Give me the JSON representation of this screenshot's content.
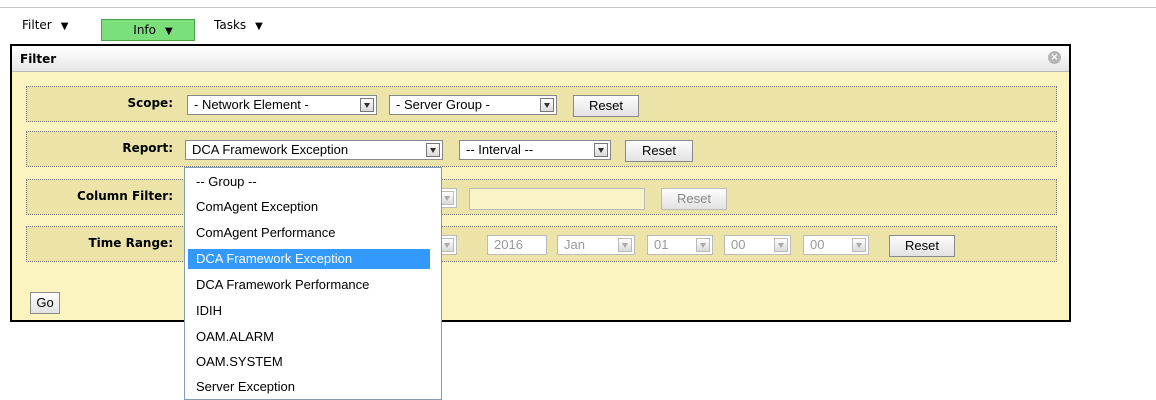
{
  "menubar": {
    "items": [
      {
        "label": "Filter"
      },
      {
        "label": "Info"
      },
      {
        "label": "Tasks"
      }
    ],
    "active_color": "#7be07b"
  },
  "panel": {
    "title": "Filter",
    "scope": {
      "label": "Scope:",
      "network_element": "- Network Element -",
      "server_group": "- Server Group -",
      "reset": "Reset"
    },
    "report": {
      "label": "Report:",
      "selected": "DCA Framework Exception",
      "interval": "-- Interval --",
      "reset": "Reset"
    },
    "column_filter": {
      "label": "Column Filter:",
      "reset": "Reset"
    },
    "time_range": {
      "label": "Time Range:",
      "year": "2016",
      "month": "Jan",
      "day": "01",
      "hour": "00",
      "minute": "00",
      "reset": "Reset"
    },
    "go": "Go"
  },
  "report_dropdown": {
    "options": [
      "-- Group --",
      "ComAgent Exception",
      "ComAgent Performance",
      "DCA Framework Exception",
      "DCA Framework Performance",
      "IDIH",
      "OAM.ALARM",
      "OAM.SYSTEM",
      "Server Exception"
    ],
    "highlighted_index": 3,
    "highlight_color": "#3399ff"
  }
}
